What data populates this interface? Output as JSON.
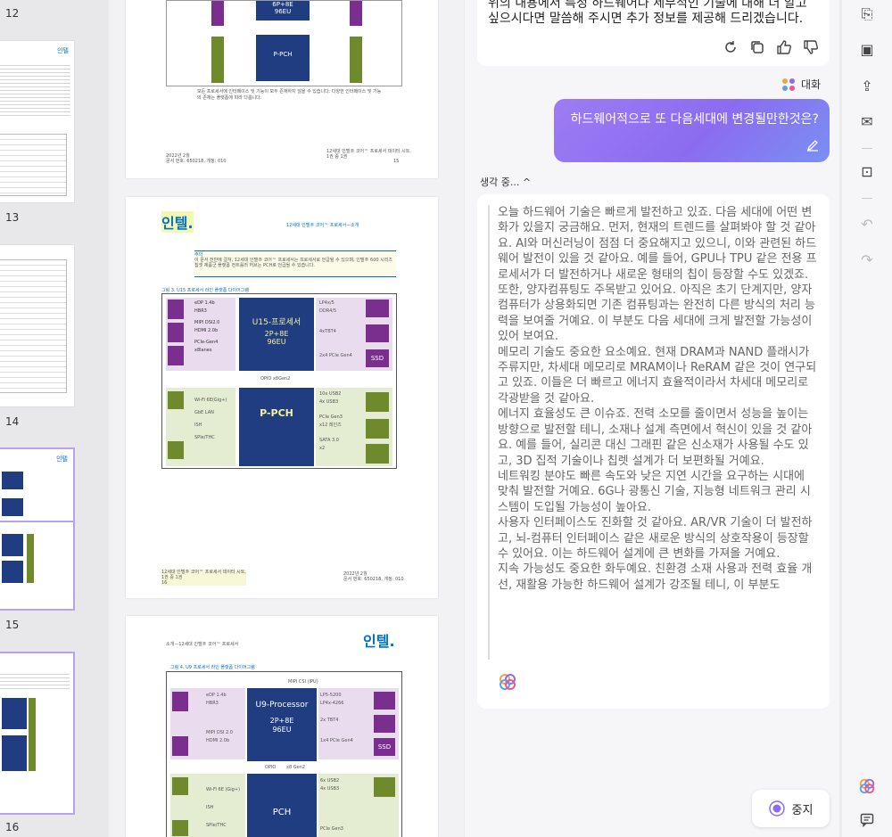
{
  "thumbnails": [
    {
      "label": "12"
    },
    {
      "label": "13"
    },
    {
      "label": "14"
    },
    {
      "label": "15"
    },
    {
      "label": "16"
    }
  ],
  "thumb_logo": "인텔",
  "page_top": {
    "cpu_line": "6P+8E\n96EU",
    "pch": "P-PCH",
    "caption": "모든 프로세서에 인터페이스 및 기능이 모두 존재하지 않을 수 있습니다. 다양한 인터페이스 및 기능의 존재는 플랫폼에 따라 다릅니다.",
    "footer_left": "2022년 2월\n문서 번호: 650218, 개정: 010",
    "footer_right": "12세대 인텔® 코어™ 프로세서 데이터 시트,\n1권 중 1권",
    "page_no": "15"
  },
  "page_mid": {
    "logo": "인텔.",
    "header": "12세대 인텔® 코어™ 프로세서—소개",
    "note_title": "주의",
    "note": "이 문서 전반에 걸쳐, 12세대 인텔® 코어™ 프로세서는 프로세서로 언급될 수 있으며, 인텔® 600 시리즈 칩셋 제품군 플랫폼 컨트롤러 허브는 PCH로 언급될 수 있습니다.",
    "fig_title": "그림 3. U15 프로세서 라인 플랫폼 다이어그램",
    "cpu_title": "U15-프로세서",
    "cpu_cores": "2P+8E\n96EU",
    "left_labels": [
      "eDP 1.4b",
      "HBR3",
      "MIPI DSI2.0",
      "HDMI 2.0b",
      "PCIe-Gen4",
      "x8lanes"
    ],
    "right_labels": [
      "LP4x/5",
      "DDR4/5",
      "4xTBT4",
      "2x4 PCIe Gen4"
    ],
    "badges": [
      "SSD"
    ],
    "opio": "OPIO x8Gen2",
    "pch": "P-PCH",
    "pch_left": [
      "Wi-Fi 6E(Gig+)",
      "GbE LAN",
      "ISH",
      "SPIe/THC"
    ],
    "pch_right": [
      "10x USB2",
      "4x USB3",
      "PCIe Gen3",
      "x12 레인즈",
      "SATA 3.0",
      "x2"
    ],
    "footer_left": "12세대 인텔® 코어™ 프로세서 데이터 시트,\n1권 중 1권\n16",
    "footer_right": "2022년 2월\n문서 번호: 650218, 개정: 010"
  },
  "page_bot": {
    "logo": "인텔.",
    "header": "소개—12세대 인텔® 코어™ 프로세서",
    "fig_title": "그림 4. U9 프로세서 라인 플랫폼 다이어그램",
    "mipi": "MIPI CSI (IPU)",
    "cpu_title": "U9-Processor",
    "cpu_cores": "2P+8E\n96EU",
    "left_labels": [
      "eDP 1.4b",
      "HBR3",
      "MIPI DSI 2.0",
      "HDMI 2.0b"
    ],
    "right_labels": [
      "LP5-5200",
      "LP4x-4266",
      "2x TBT4",
      "1x4 PCIe Gen4"
    ],
    "badge": "SSD",
    "opio": "OPIO",
    "opio2": "x8 Gen2",
    "pch": "PCH",
    "pch_left": [
      "Wi-Fi 6E (Gig+)",
      "ISH",
      "SPIe/THC"
    ],
    "pch_right": [
      "6x USB2",
      "4x USB3",
      "PCIe Gen3"
    ]
  },
  "chat": {
    "prev_text": "위의 내용에서 특정 하드웨어나 세부적인 기술에 대해 더 알고 싶으시다면 말씀해 주시면 추가 정보를 제공해 드리겠습니다.",
    "assistant_label": "대화",
    "user_message": "하드웨어적으로 또 다음세대에 변경될만한것은?",
    "thinking_label": "생각 중... ^",
    "paragraphs": [
      "오늘 하드웨어 기술은 빠르게 발전하고 있죠. 다음 세대에 어떤 변화가 있을지 궁금해요. 먼저, 현재의 트렌드를 살펴봐야 할 것 같아요. AI와 머신러닝이 점점 더 중요해지고 있으니, 이와 관련된 하드웨어 발전이 있을 것 같아요. 예를 들어, GPU나 TPU 같은 전용 프로세서가 더 발전하거나 새로운 형태의 칩이 등장할 수도 있겠죠.",
      "또한, 양자컴퓨팅도 주목받고 있어요. 아직은 초기 단계지만, 양자 컴퓨터가 상용화되면 기존 컴퓨팅과는 완전히 다른 방식의 처리 능력을 보여줄 거예요. 이 부분도 다음 세대에 크게 발전할 가능성이 있어 보여요.",
      "메모리 기술도 중요한 요소예요. 현재 DRAM과 NAND 플래시가 주류지만, 차세대 메모리로 MRAM이나 ReRAM 같은 것이 연구되고 있죠. 이들은 더 빠르고 에너지 효율적이라서 차세대 메모리로 각광받을 것 같아요.",
      "에너지 효율성도 큰 이슈죠. 전력 소모를 줄이면서 성능을 높이는 방향으로 발전할 테니, 소재나 설계 측면에서 혁신이 있을 것 같아요. 예를 들어, 실리콘 대신 그래핀 같은 신소재가 사용될 수도 있고, 3D 집적 기술이나 칩렛 설계가 더 보편화될 거예요.",
      "네트워킹 분야도 빠른 속도와 낮은 지연 시간을 요구하는 시대에 맞춰 발전할 거예요. 6G나 광통신 기술, 지능형 네트워크 관리 시스템이 도입될 가능성이 높아요.",
      "사용자 인터페이스도 진화할 것 같아요. AR/VR 기술이 더 발전하고, 뇌-컴퓨터 인터페이스 같은 새로운 방식의 상호작용이 등장할 수 있어요. 이는 하드웨어 설계에 큰 변화를 가져올 거예요.",
      "지속 가능성도 중요한 화두예요. 친환경 소재 사용과 전력 효율 개선, 재활용 가능한 하드웨어 설계가 강조될 테니, 이 부분도"
    ],
    "stop_label": "중지"
  },
  "colors": {
    "accent": "#8b6cf0",
    "purple": "#7a2f8f",
    "green": "#6f8a2c",
    "navy": "#1f3d80",
    "cyan": "#0071c5"
  }
}
